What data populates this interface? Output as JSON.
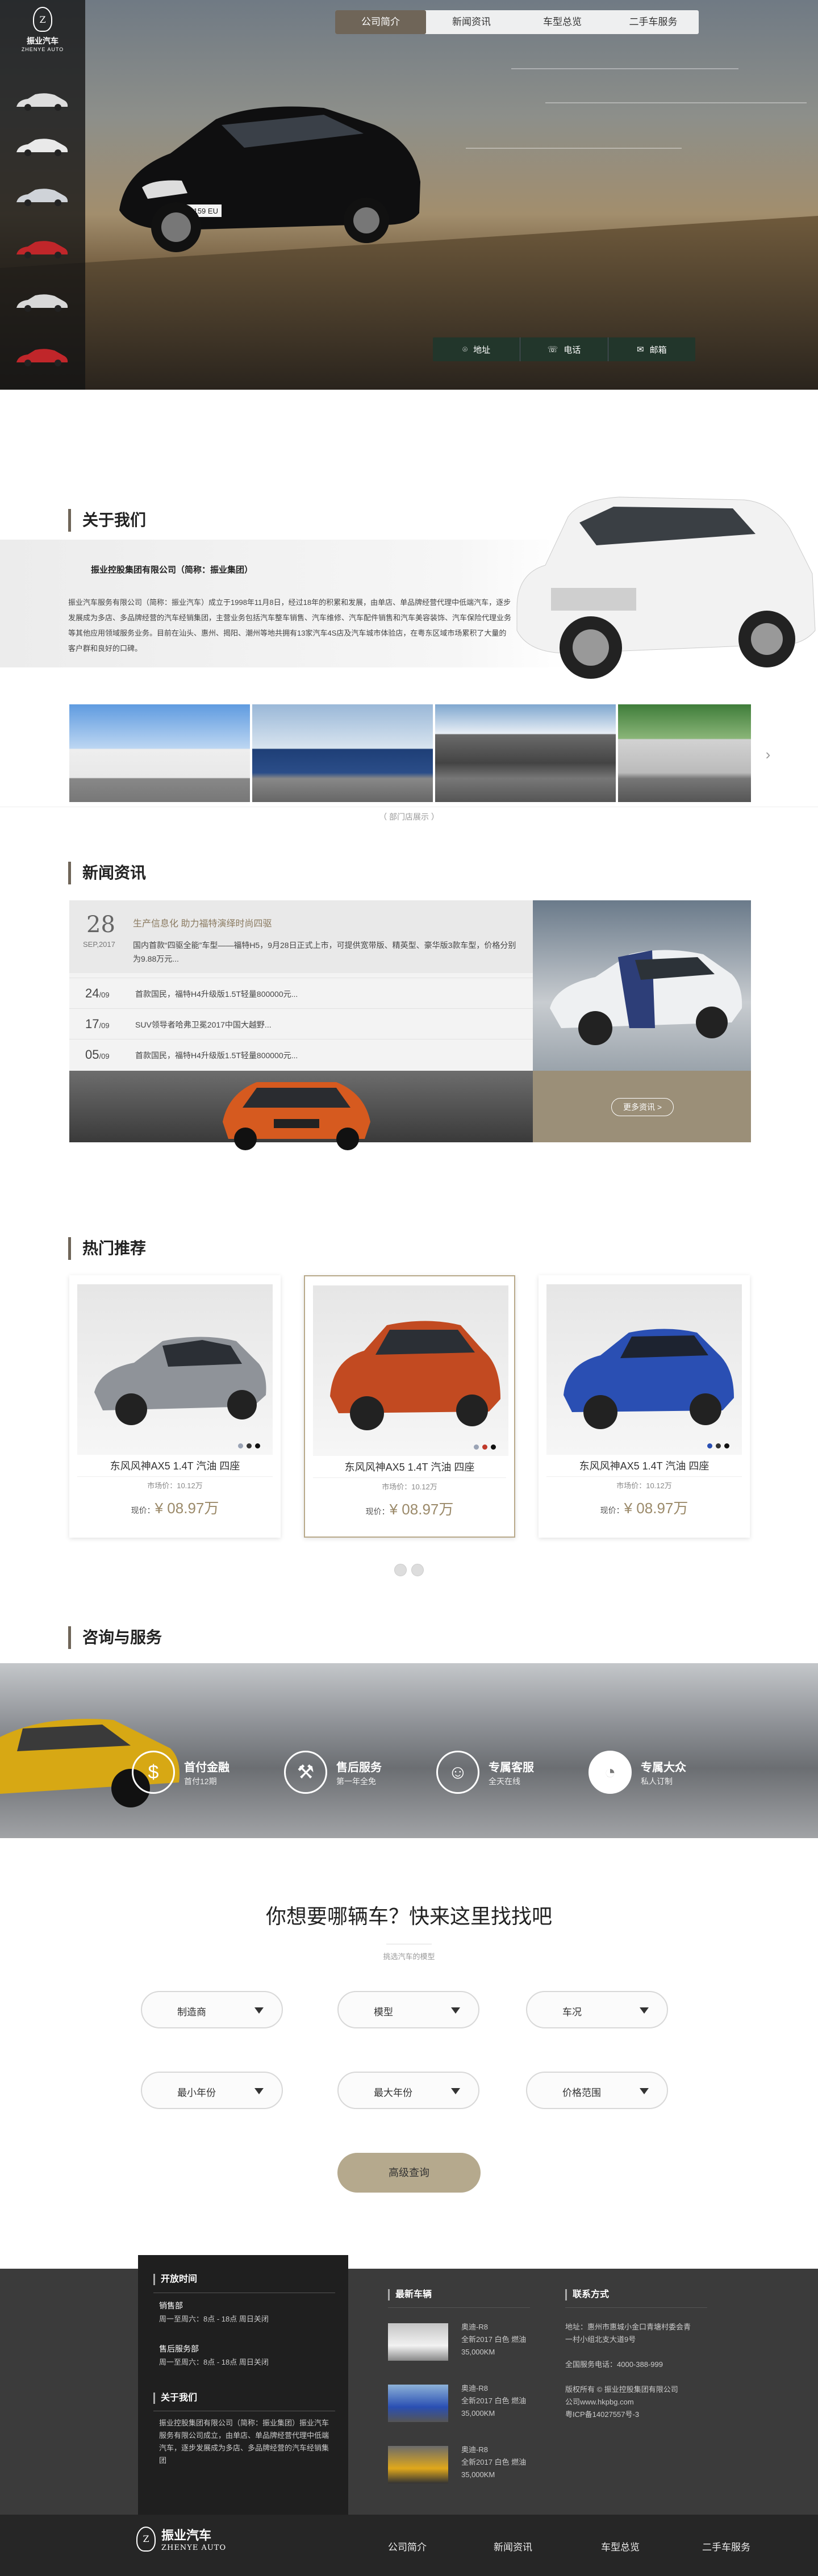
{
  "brand": {
    "name_cn": "振业汽车",
    "name_en": "ZHENYE AUTO"
  },
  "nav": [
    {
      "label": "公司简介",
      "active": true
    },
    {
      "label": "新闻资讯",
      "active": false
    },
    {
      "label": "车型总览",
      "active": false
    },
    {
      "label": "二手车服务",
      "active": false
    }
  ],
  "hero": {
    "plate": "粤L-159 EU"
  },
  "contact_bar": [
    {
      "icon": "location-pin-icon",
      "label": "地址"
    },
    {
      "icon": "phone-icon",
      "label": "电话"
    },
    {
      "icon": "mail-icon",
      "label": "邮箱"
    }
  ],
  "about": {
    "title": "关于我们",
    "company": "振业控股集团有限公司（简称：振业集团）",
    "text": "振业汽车服务有限公司（简称：振业汽车）成立于1998年11月8日，经过18年的积累和发展，由单店、单品牌经营代理中低端汽车，逐步发展成为多店、多品牌经营的汽车经销集团，主营业务包括汽车整车销售、汽车维修、汽车配件销售和汽车美容装饰、汽车保险代理业务等其他应用领域服务业务。目前在汕头、惠州、揭阳、潮州等地共拥有13家汽车4S店及汽车城市体验店，在粤东区域市场累积了大量的客户群和良好的口碑。",
    "gallery_caption": "（ 部门店展示 ）"
  },
  "news": {
    "title": "新闻资讯",
    "feature": {
      "day": "28",
      "month_year": "SEP,2017",
      "title": "生产信息化 助力福特演绎时尚四驱",
      "body": "国内首款“四驱全能”车型——福特H5，9月28日正式上市，可提供宽带版、精英型、豪华版3款车型，价格分别为9.88万元..."
    },
    "items": [
      {
        "day": "24",
        "month": "/09",
        "title": "首款国民，福特H4升级版1.5T轻量800000元..."
      },
      {
        "day": "17",
        "month": "/09",
        "title": "SUV领导者哈弗卫冕2017中国大越野..."
      },
      {
        "day": "05",
        "month": "/09",
        "title": "首款国民，福特H4升级版1.5T轻量800000元..."
      }
    ],
    "more": "更多资讯 >"
  },
  "hot": {
    "title": "热门推荐",
    "cards": [
      {
        "name": "东风风神AX5   1.4T 汽油 四座",
        "market": "市场价：10.12万",
        "price_label": "现价：",
        "price": "¥ 08.97万",
        "active": false,
        "color": "#8f9399",
        "dots": [
          "#9aa3b5",
          "#333",
          "#111"
        ]
      },
      {
        "name": "东风风神AX5   1.4T 汽油 四座",
        "market": "市场价：10.12万",
        "price_label": "现价：",
        "price": "¥ 08.97万",
        "active": true,
        "color": "#c24a21",
        "dots": [
          "#9aa3b5",
          "#c03a2b",
          "#111"
        ]
      },
      {
        "name": "东风风神AX5   1.4T 汽油 四座",
        "market": "市场价：10.12万",
        "price_label": "现价：",
        "price": "¥ 08.97万",
        "active": false,
        "color": "#2a4fb3",
        "dots": [
          "#2a4fb3",
          "#333",
          "#111"
        ]
      }
    ]
  },
  "services": {
    "title": "咨询与服务",
    "items": [
      {
        "icon": "dollar-icon",
        "title": "首付金融",
        "sub": "首付12期"
      },
      {
        "icon": "wrench-icon",
        "title": "售后服务",
        "sub": "第一年全免"
      },
      {
        "icon": "person-icon",
        "title": "专属客服",
        "sub": "全天在线"
      },
      {
        "icon": "pie-icon",
        "title": "专属大众",
        "sub": "私人订制"
      }
    ]
  },
  "search": {
    "title": "你想要哪辆车？快来这里找找吧",
    "subtitle": "挑选汽车的模型",
    "selects": [
      "制造商",
      "模型",
      "车况",
      "最小年份",
      "最大年份",
      "价格范围"
    ],
    "button": "高级查询"
  },
  "footer": {
    "hours_title": "开放时间",
    "sales_dept": "销售部",
    "sales_hours": "周一至周六：8点 - 18点   周日关闭",
    "service_dept": "售后服务部",
    "service_hours": "周一至周六：8点 - 18点   周日关闭",
    "about_title": "关于我们",
    "about_text": "振业控股集团有限公司（简称：振业集团）振业汽车服务有限公司成立，由单店、单品牌经营代理中低端汽车，逐步发展成为多店、多品牌经营的汽车经销集团",
    "latest_title": "最新车辆",
    "latest": [
      {
        "name": "奥迪-R8",
        "spec": "全新2017 白色 燃油",
        "km": "35,000KM"
      },
      {
        "name": "奥迪-R8",
        "spec": "全新2017 白色 燃油",
        "km": "35,000KM"
      },
      {
        "name": "奥迪-R8",
        "spec": "全新2017 白色 燃油",
        "km": "35,000KM"
      }
    ],
    "contact_title": "联系方式",
    "address": "地址：惠州市惠城小金口青塘村委会青一村小组北支大道9号",
    "hotline": "全国服务电话：4000-388-999",
    "copyright": "版权所有 © 振业控股集团有限公司",
    "website": "公司www.hkpbg.com",
    "icp": "粤ICP备14027557号-3"
  },
  "bottom_nav": [
    "公司简介",
    "新闻资讯",
    "车型总览",
    "二手车服务"
  ]
}
